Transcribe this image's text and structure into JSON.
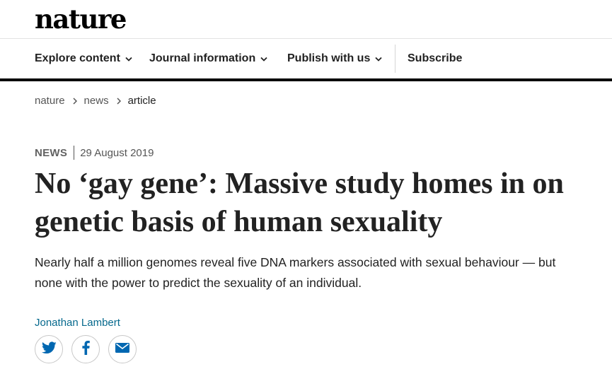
{
  "header": {
    "logo_text": "nature"
  },
  "nav": {
    "items": [
      {
        "label": "Explore content",
        "icon": "chevron-down-icon"
      },
      {
        "label": "Journal information",
        "icon": "chevron-down-icon"
      },
      {
        "label": "Publish with us",
        "icon": "chevron-down-icon"
      }
    ],
    "subscribe_label": "Subscribe"
  },
  "breadcrumb": {
    "items": [
      "nature",
      "news"
    ],
    "current": "article"
  },
  "article": {
    "type": "NEWS",
    "date": "29 August 2019",
    "title": "No ‘gay gene’: Massive study homes in on genetic basis of human sexuality",
    "standfirst": "Nearly half a million genomes reveal five DNA markers associated with sexual behaviour — but none with the power to predict the sexuality of an individual.",
    "author": "Jonathan Lambert",
    "share_icons": [
      "twitter-icon",
      "facebook-icon",
      "email-icon"
    ]
  },
  "colors": {
    "text": "#222222",
    "author_link": "#06698d",
    "nav_rule": "#000000",
    "share_icon": "#0067b1"
  }
}
